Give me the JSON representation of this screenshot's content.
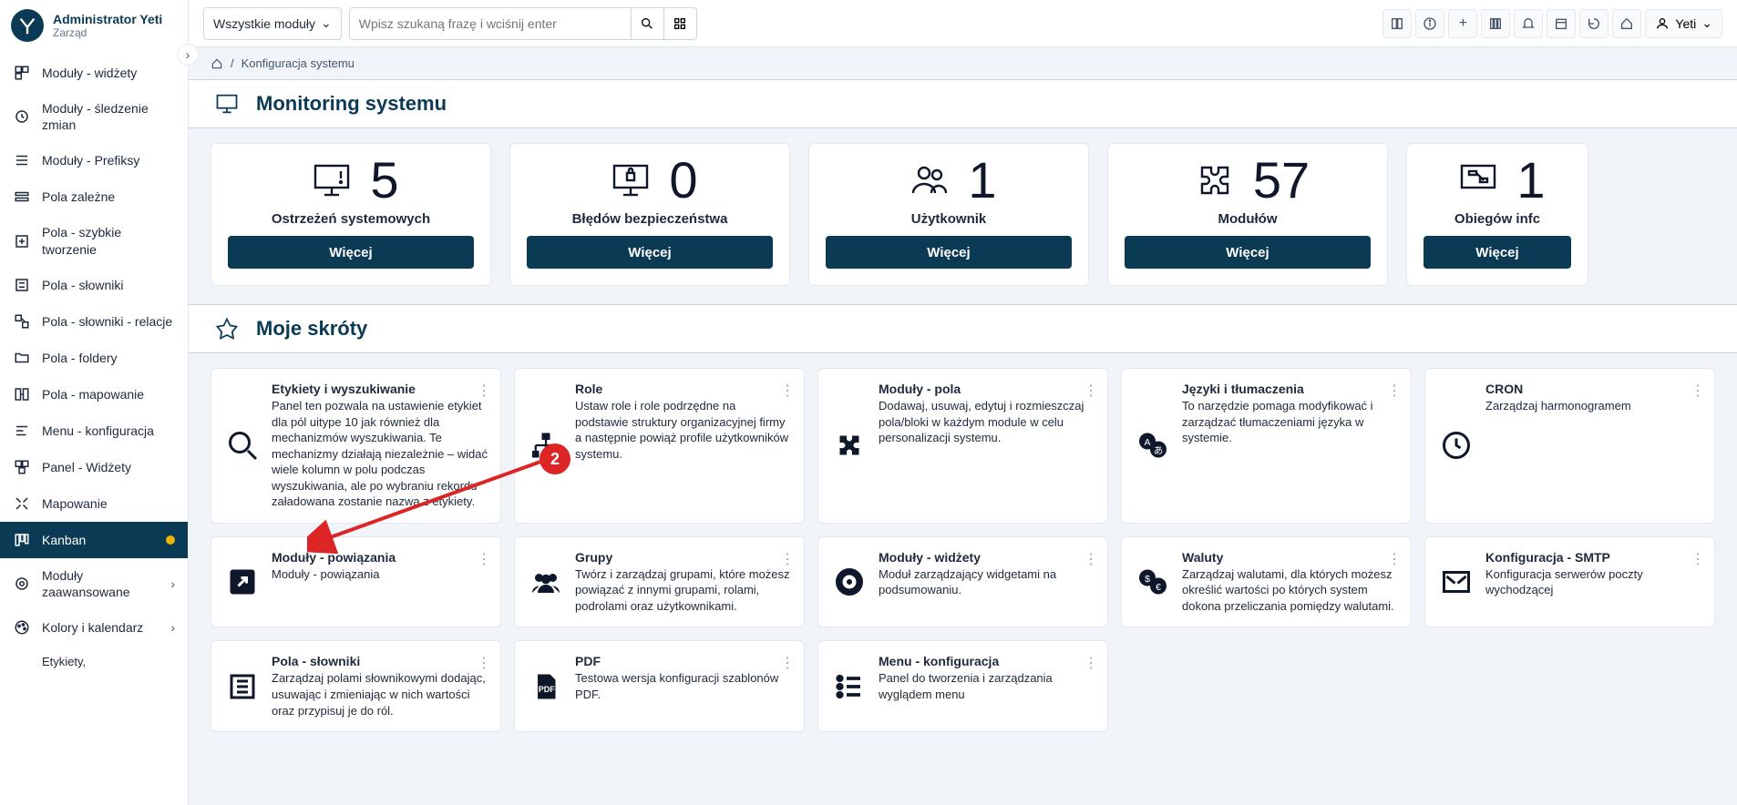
{
  "header": {
    "admin_name": "Administrator Yeti",
    "admin_sub": "Zarząd"
  },
  "topbar": {
    "module_select": "Wszystkie moduły",
    "search_placeholder": "Wpisz szukaną frazę i wciśnij enter",
    "user_label": "Yeti"
  },
  "breadcrumb": {
    "current": "Konfiguracja systemu"
  },
  "sidebar": {
    "items": [
      {
        "label": "Moduły - widżety"
      },
      {
        "label": "Moduły - śledzenie zmian"
      },
      {
        "label": "Moduły - Prefiksy"
      },
      {
        "label": "Pola zależne"
      },
      {
        "label": "Pola - szybkie tworzenie"
      },
      {
        "label": "Pola - słowniki"
      },
      {
        "label": "Pola - słowniki - relacje"
      },
      {
        "label": "Pola - foldery"
      },
      {
        "label": "Pola - mapowanie"
      },
      {
        "label": "Menu - konfiguracja"
      },
      {
        "label": "Panel - Widżety"
      },
      {
        "label": "Mapowanie"
      },
      {
        "label": "Kanban"
      },
      {
        "label": "Moduły zaawansowane"
      },
      {
        "label": "Kolory i kalendarz"
      },
      {
        "label": "Etykiety,"
      }
    ]
  },
  "sections": {
    "monitoring": "Monitoring systemu",
    "shortcuts": "Moje skróty"
  },
  "monitoring": {
    "more_label": "Więcej",
    "cards": [
      {
        "value": "5",
        "label": "Ostrzeżeń systemowych"
      },
      {
        "value": "0",
        "label": "Błędów bezpieczeństwa"
      },
      {
        "value": "1",
        "label": "Użytkownik"
      },
      {
        "value": "57",
        "label": "Modułów"
      },
      {
        "value": "1",
        "label": "Obiegów infc"
      }
    ]
  },
  "shortcuts": [
    {
      "title": "Etykiety i wyszukiwanie",
      "desc": "Panel ten pozwala na ustawienie etykiet dla pól uitype 10 jak również dla mechanizmów wyszukiwania. Te mechanizmy działają niezależnie – widać wiele kolumn w polu podczas wyszukiwania, ale po wybraniu rekordu załadowana zostanie nazwa z etykiety."
    },
    {
      "title": "Role",
      "desc": "Ustaw role i role podrzędne na podstawie struktury organizacyjnej firmy a następnie powiąż profile użytkowników systemu."
    },
    {
      "title": "Moduły - pola",
      "desc": "Dodawaj, usuwaj, edytuj i rozmieszczaj pola/bloki w każdym module w celu personalizacji systemu."
    },
    {
      "title": "Języki i tłumaczenia",
      "desc": "To narzędzie pomaga modyfikować i zarządzać tłumaczeniami języka w systemie."
    },
    {
      "title": "CRON",
      "desc": "Zarządzaj harmonogramem"
    },
    {
      "title": "Moduły - powiązania",
      "desc": "Moduły - powiązania"
    },
    {
      "title": "Grupy",
      "desc": "Twórz i zarządzaj grupami, które możesz powiązać z innymi grupami, rolami, podrolami oraz użytkownikami."
    },
    {
      "title": "Moduły - widżety",
      "desc": "Moduł zarządzający widgetami na podsumowaniu."
    },
    {
      "title": "Waluty",
      "desc": "Zarządzaj walutami, dla których możesz określić wartości po których system dokona przeliczania pomiędzy walutami."
    },
    {
      "title": "Konfiguracja - SMTP",
      "desc": "Konfiguracja serwerów poczty wychodzącej"
    },
    {
      "title": "Pola - słowniki",
      "desc": "Zarządzaj polami słownikowymi dodając, usuwając i zmieniając w nich wartości oraz przypisuj je do ról."
    },
    {
      "title": "PDF",
      "desc": "Testowa wersja konfiguracji szablonów PDF."
    },
    {
      "title": "Menu - konfiguracja",
      "desc": "Panel do tworzenia i zarządzania wyglądem menu"
    }
  ],
  "annotation": {
    "badge": "2"
  }
}
